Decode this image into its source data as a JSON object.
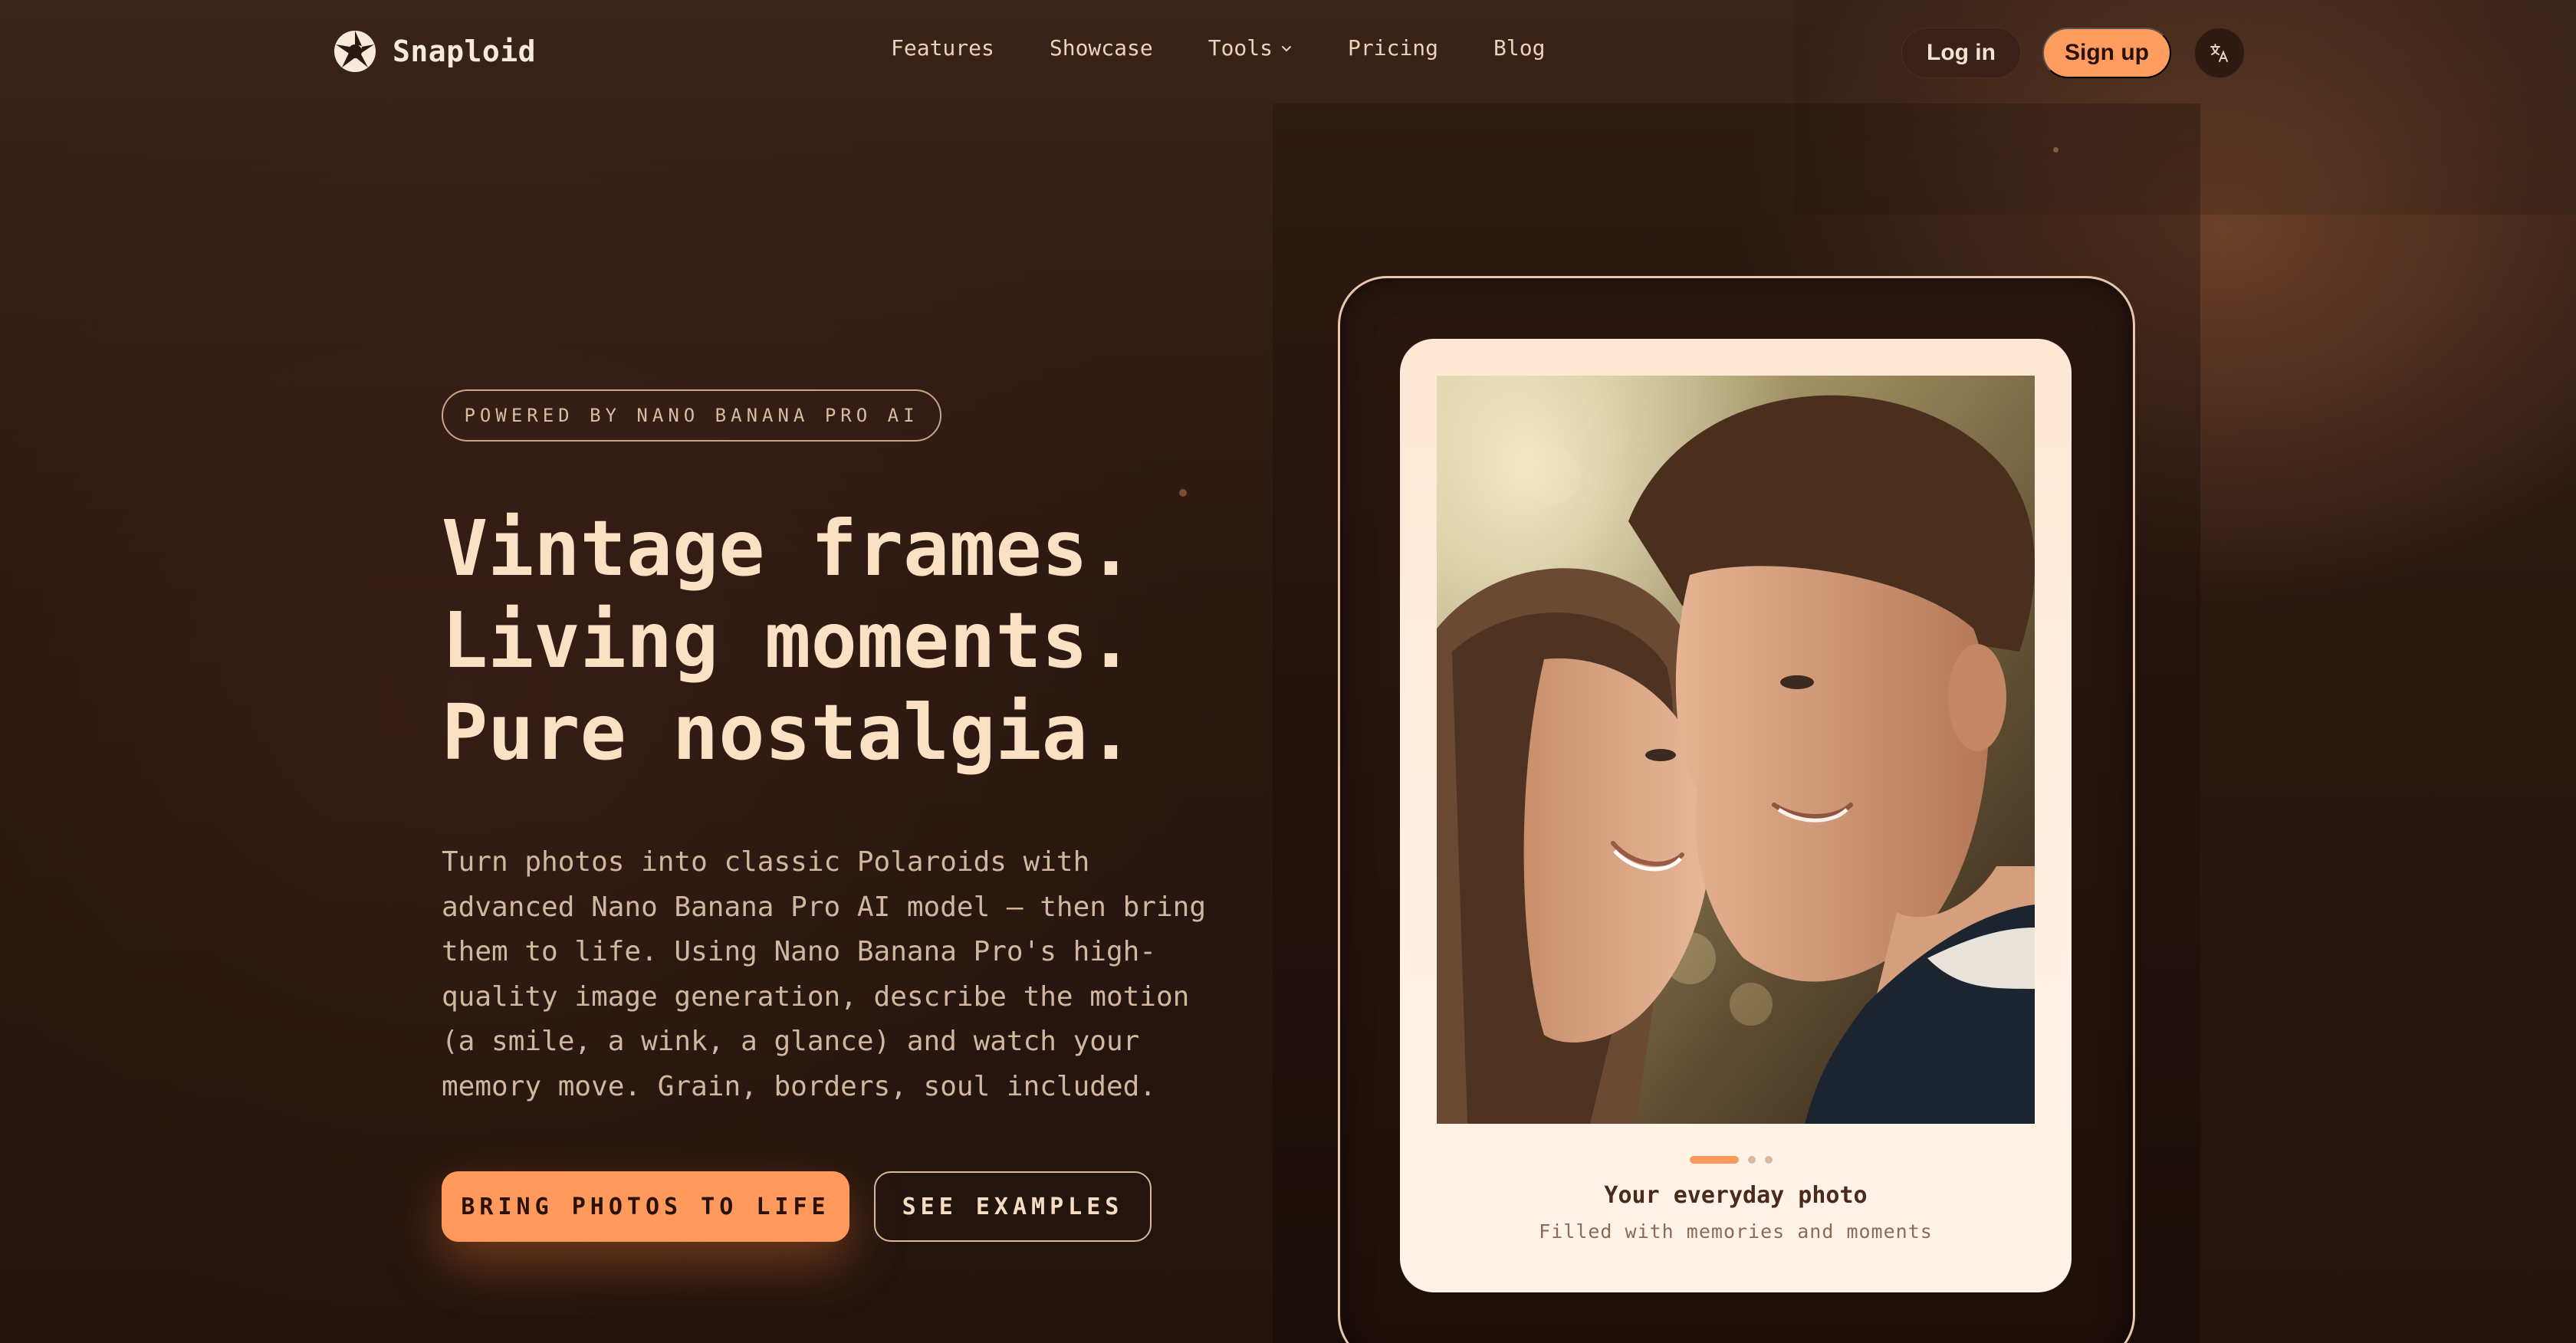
{
  "brand": {
    "name": "Snaploid"
  },
  "nav": {
    "items": [
      {
        "label": "Features"
      },
      {
        "label": "Showcase"
      },
      {
        "label": "Tools"
      },
      {
        "label": "Pricing"
      },
      {
        "label": "Blog"
      }
    ]
  },
  "header": {
    "login_label": "Log in",
    "signup_label": "Sign up",
    "language_icon": "translate-icon"
  },
  "hero": {
    "badge": "POWERED BY NANO BANANA PRO AI",
    "headline": [
      "Vintage frames.",
      "Living moments.",
      "Pure nostalgia."
    ],
    "description": "Turn photos into classic Polaroids with advanced Nano Banana Pro AI model — then bring them to life. Using Nano Banana Pro's high-quality image generation, describe the motion (a smile, a wink, a glance) and watch your memory move. Grain, borders, soul included.",
    "cta_primary": "BRING PHOTOS TO LIFE",
    "cta_secondary": "SEE EXAMPLES"
  },
  "showcase_card": {
    "title": "Your everyday photo",
    "subtitle": "Filled with memories and moments",
    "slide_count": 3,
    "active_slide": 1
  },
  "colors": {
    "accent": "#ff9a5c",
    "background": "#2a1710",
    "text": "#fbe1c4",
    "card": "#ffefe2"
  }
}
